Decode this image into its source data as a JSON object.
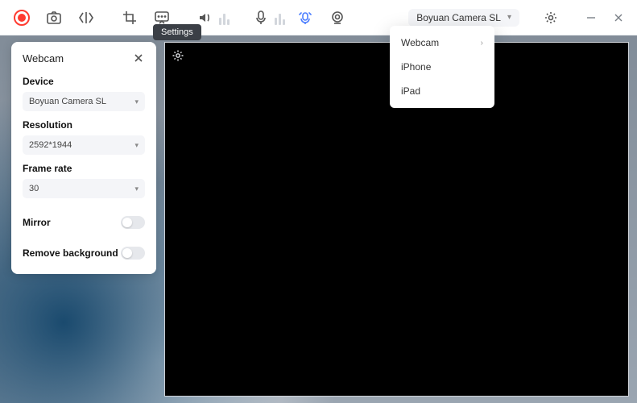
{
  "toolbar": {
    "tooltip_settings": "Settings",
    "camera_selected": "Boyuan Camera SL"
  },
  "camera_menu": {
    "items": [
      {
        "label": "Webcam",
        "has_submenu": true
      },
      {
        "label": "iPhone",
        "has_submenu": false
      },
      {
        "label": "iPad",
        "has_submenu": false
      }
    ]
  },
  "panel": {
    "title": "Webcam",
    "device_label": "Device",
    "device_value": "Boyuan Camera SL",
    "resolution_label": "Resolution",
    "resolution_value": "2592*1944",
    "framerate_label": "Frame rate",
    "framerate_value": "30",
    "mirror_label": "Mirror",
    "mirror_on": false,
    "remove_bg_label": "Remove background",
    "remove_bg_on": false
  },
  "colors": {
    "record": "#ff3b30",
    "accent_mic": "#4b7dff",
    "panel_bg": "#ffffff",
    "select_bg": "#f4f5f8"
  }
}
